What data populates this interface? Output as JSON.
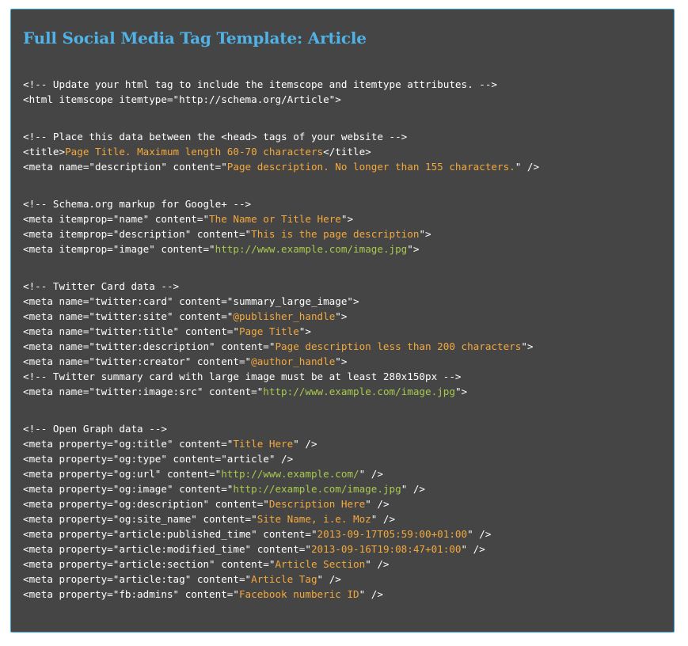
{
  "title": "Full Social Media Tag Template: Article",
  "colors": {
    "background": "#454545",
    "border": "#3aa0d4",
    "title": "#4fb3e8",
    "value": "#f4a93d",
    "url": "#a8c94f",
    "text": "#ffffff"
  },
  "blocks": [
    [
      [
        {
          "t": "<!-- Update your html tag to include the itemscope and itemtype attributes. -->",
          "c": ""
        }
      ],
      [
        {
          "t": "<html itemscope itemtype=\"http://schema.org/Article\">",
          "c": ""
        }
      ]
    ],
    [
      [
        {
          "t": "<!-- Place this data between the <head> tags of your website -->",
          "c": ""
        }
      ],
      [
        {
          "t": "<title>",
          "c": ""
        },
        {
          "t": "Page Title. Maximum length 60-70 characters",
          "c": "hl"
        },
        {
          "t": "</title>",
          "c": ""
        }
      ],
      [
        {
          "t": "<meta name=\"description\" content=\"",
          "c": ""
        },
        {
          "t": "Page description. No longer than 155 characters.",
          "c": "hl"
        },
        {
          "t": "\" />",
          "c": ""
        }
      ]
    ],
    [
      [
        {
          "t": "<!-- Schema.org markup for Google+ -->",
          "c": ""
        }
      ],
      [
        {
          "t": "<meta itemprop=\"name\" content=\"",
          "c": ""
        },
        {
          "t": "The Name or Title Here",
          "c": "hl"
        },
        {
          "t": "\">",
          "c": ""
        }
      ],
      [
        {
          "t": "<meta itemprop=\"description\" content=\"",
          "c": ""
        },
        {
          "t": "This is the page description",
          "c": "hl"
        },
        {
          "t": "\">",
          "c": ""
        }
      ],
      [
        {
          "t": "<meta itemprop=\"image\" content=\"",
          "c": ""
        },
        {
          "t": "http://www.example.com/image.jpg",
          "c": "url"
        },
        {
          "t": "\">",
          "c": ""
        }
      ]
    ],
    [
      [
        {
          "t": "<!-- Twitter Card data -->",
          "c": ""
        }
      ],
      [
        {
          "t": "<meta name=\"twitter:card\" content=\"summary_large_image\">",
          "c": ""
        }
      ],
      [
        {
          "t": "<meta name=\"twitter:site\" content=\"",
          "c": ""
        },
        {
          "t": "@publisher_handle",
          "c": "hl"
        },
        {
          "t": "\">",
          "c": ""
        }
      ],
      [
        {
          "t": "<meta name=\"twitter:title\" content=\"",
          "c": ""
        },
        {
          "t": "Page Title",
          "c": "hl"
        },
        {
          "t": "\">",
          "c": ""
        }
      ],
      [
        {
          "t": "<meta name=\"twitter:description\" content=\"",
          "c": ""
        },
        {
          "t": "Page description less than 200 characters",
          "c": "hl"
        },
        {
          "t": "\">",
          "c": ""
        }
      ],
      [
        {
          "t": "<meta name=\"twitter:creator\" content=\"",
          "c": ""
        },
        {
          "t": "@author_handle",
          "c": "hl"
        },
        {
          "t": "\">",
          "c": ""
        }
      ],
      [
        {
          "t": "<!-- Twitter summary card with large image must be at least 280x150px -->",
          "c": ""
        }
      ],
      [
        {
          "t": "<meta name=\"twitter:image:src\" content=\"",
          "c": ""
        },
        {
          "t": "http://www.example.com/image.jpg",
          "c": "url"
        },
        {
          "t": "\">",
          "c": ""
        }
      ]
    ],
    [
      [
        {
          "t": "<!-- Open Graph data -->",
          "c": ""
        }
      ],
      [
        {
          "t": "<meta property=\"og:title\" content=\"",
          "c": ""
        },
        {
          "t": "Title Here",
          "c": "hl"
        },
        {
          "t": "\" />",
          "c": ""
        }
      ],
      [
        {
          "t": "<meta property=\"og:type\" content=\"article\" />",
          "c": ""
        }
      ],
      [
        {
          "t": "<meta property=\"og:url\" content=\"",
          "c": ""
        },
        {
          "t": "http://www.example.com/",
          "c": "url"
        },
        {
          "t": "\" />",
          "c": ""
        }
      ],
      [
        {
          "t": "<meta property=\"og:image\" content=\"",
          "c": ""
        },
        {
          "t": "http://example.com/image.jpg",
          "c": "url"
        },
        {
          "t": "\" />",
          "c": ""
        }
      ],
      [
        {
          "t": "<meta property=\"og:description\" content=\"",
          "c": ""
        },
        {
          "t": "Description Here",
          "c": "hl"
        },
        {
          "t": "\" />",
          "c": ""
        }
      ],
      [
        {
          "t": "<meta property=\"og:site_name\" content=\"",
          "c": ""
        },
        {
          "t": "Site Name, i.e. Moz",
          "c": "hl"
        },
        {
          "t": "\" />",
          "c": ""
        }
      ],
      [
        {
          "t": "<meta property=\"article:published_time\" content=\"",
          "c": ""
        },
        {
          "t": "2013-09-17T05:59:00+01:00",
          "c": "hl"
        },
        {
          "t": "\" />",
          "c": ""
        }
      ],
      [
        {
          "t": "<meta property=\"article:modified_time\" content=\"",
          "c": ""
        },
        {
          "t": "2013-09-16T19:08:47+01:00",
          "c": "hl"
        },
        {
          "t": "\" />",
          "c": ""
        }
      ],
      [
        {
          "t": "<meta property=\"article:section\" content=\"",
          "c": ""
        },
        {
          "t": "Article Section",
          "c": "hl"
        },
        {
          "t": "\" />",
          "c": ""
        }
      ],
      [
        {
          "t": "<meta property=\"article:tag\" content=\"",
          "c": ""
        },
        {
          "t": "Article Tag",
          "c": "hl"
        },
        {
          "t": "\" />",
          "c": ""
        }
      ],
      [
        {
          "t": "<meta property=\"fb:admins\" content=\"",
          "c": ""
        },
        {
          "t": "Facebook numberic ID",
          "c": "hl"
        },
        {
          "t": "\" />",
          "c": ""
        }
      ]
    ]
  ]
}
